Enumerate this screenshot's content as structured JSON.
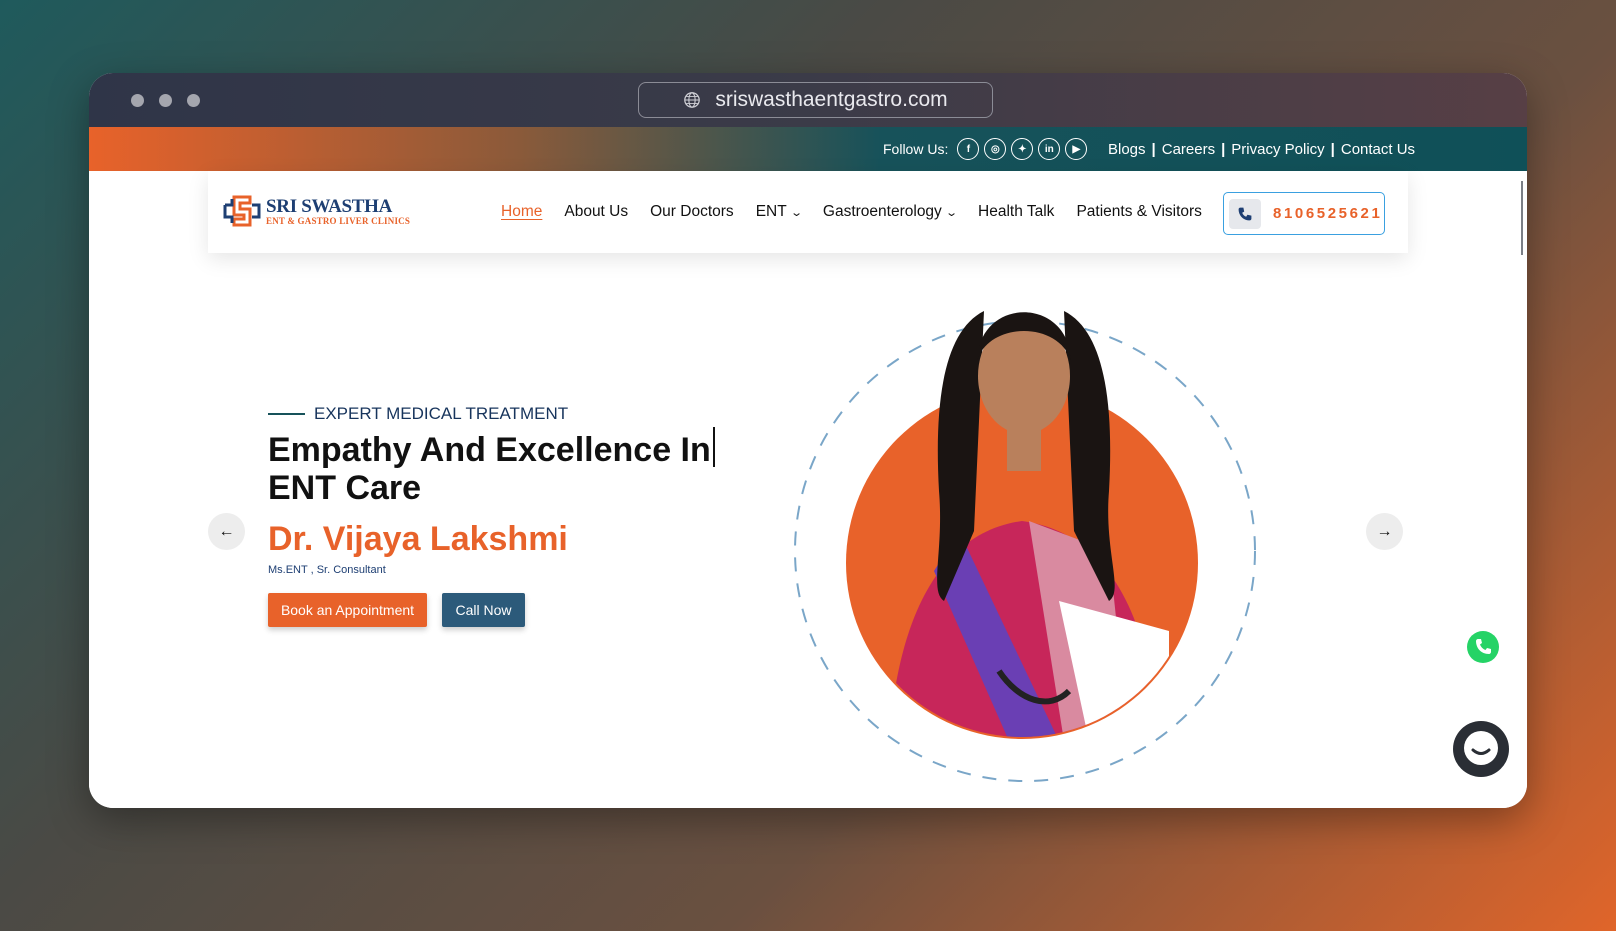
{
  "browser": {
    "url": "sriswasthaentgastro.com"
  },
  "topbar": {
    "follow_label": "Follow Us:",
    "social": [
      "f",
      "ig",
      "tw",
      "in",
      "yt"
    ],
    "links": [
      "Blogs",
      "Careers",
      "Privacy Policy",
      "Contact Us"
    ]
  },
  "logo": {
    "title": "SRI SWASTHA",
    "subtitle": "ENT & GASTRO LIVER CLINICS"
  },
  "nav": {
    "items": [
      "Home",
      "About Us",
      "Our Doctors",
      "ENT",
      "Gastroenterology",
      "Health Talk",
      "Patients & Visitors"
    ],
    "phone": "8106525621"
  },
  "hero": {
    "eyebrow": "EXPERT MEDICAL TREATMENT",
    "headline_line1": "Empathy And Excellence In",
    "headline_line2": "ENT Care",
    "doctor_name": "Dr. Vijaya Lakshmi",
    "credentials": "Ms.ENT , Sr. Consultant",
    "book_label": "Book an Appointment",
    "call_label": "Call Now"
  },
  "colors": {
    "accent": "#e8622a",
    "teal": "#17525a",
    "navy": "#1e3f73"
  }
}
